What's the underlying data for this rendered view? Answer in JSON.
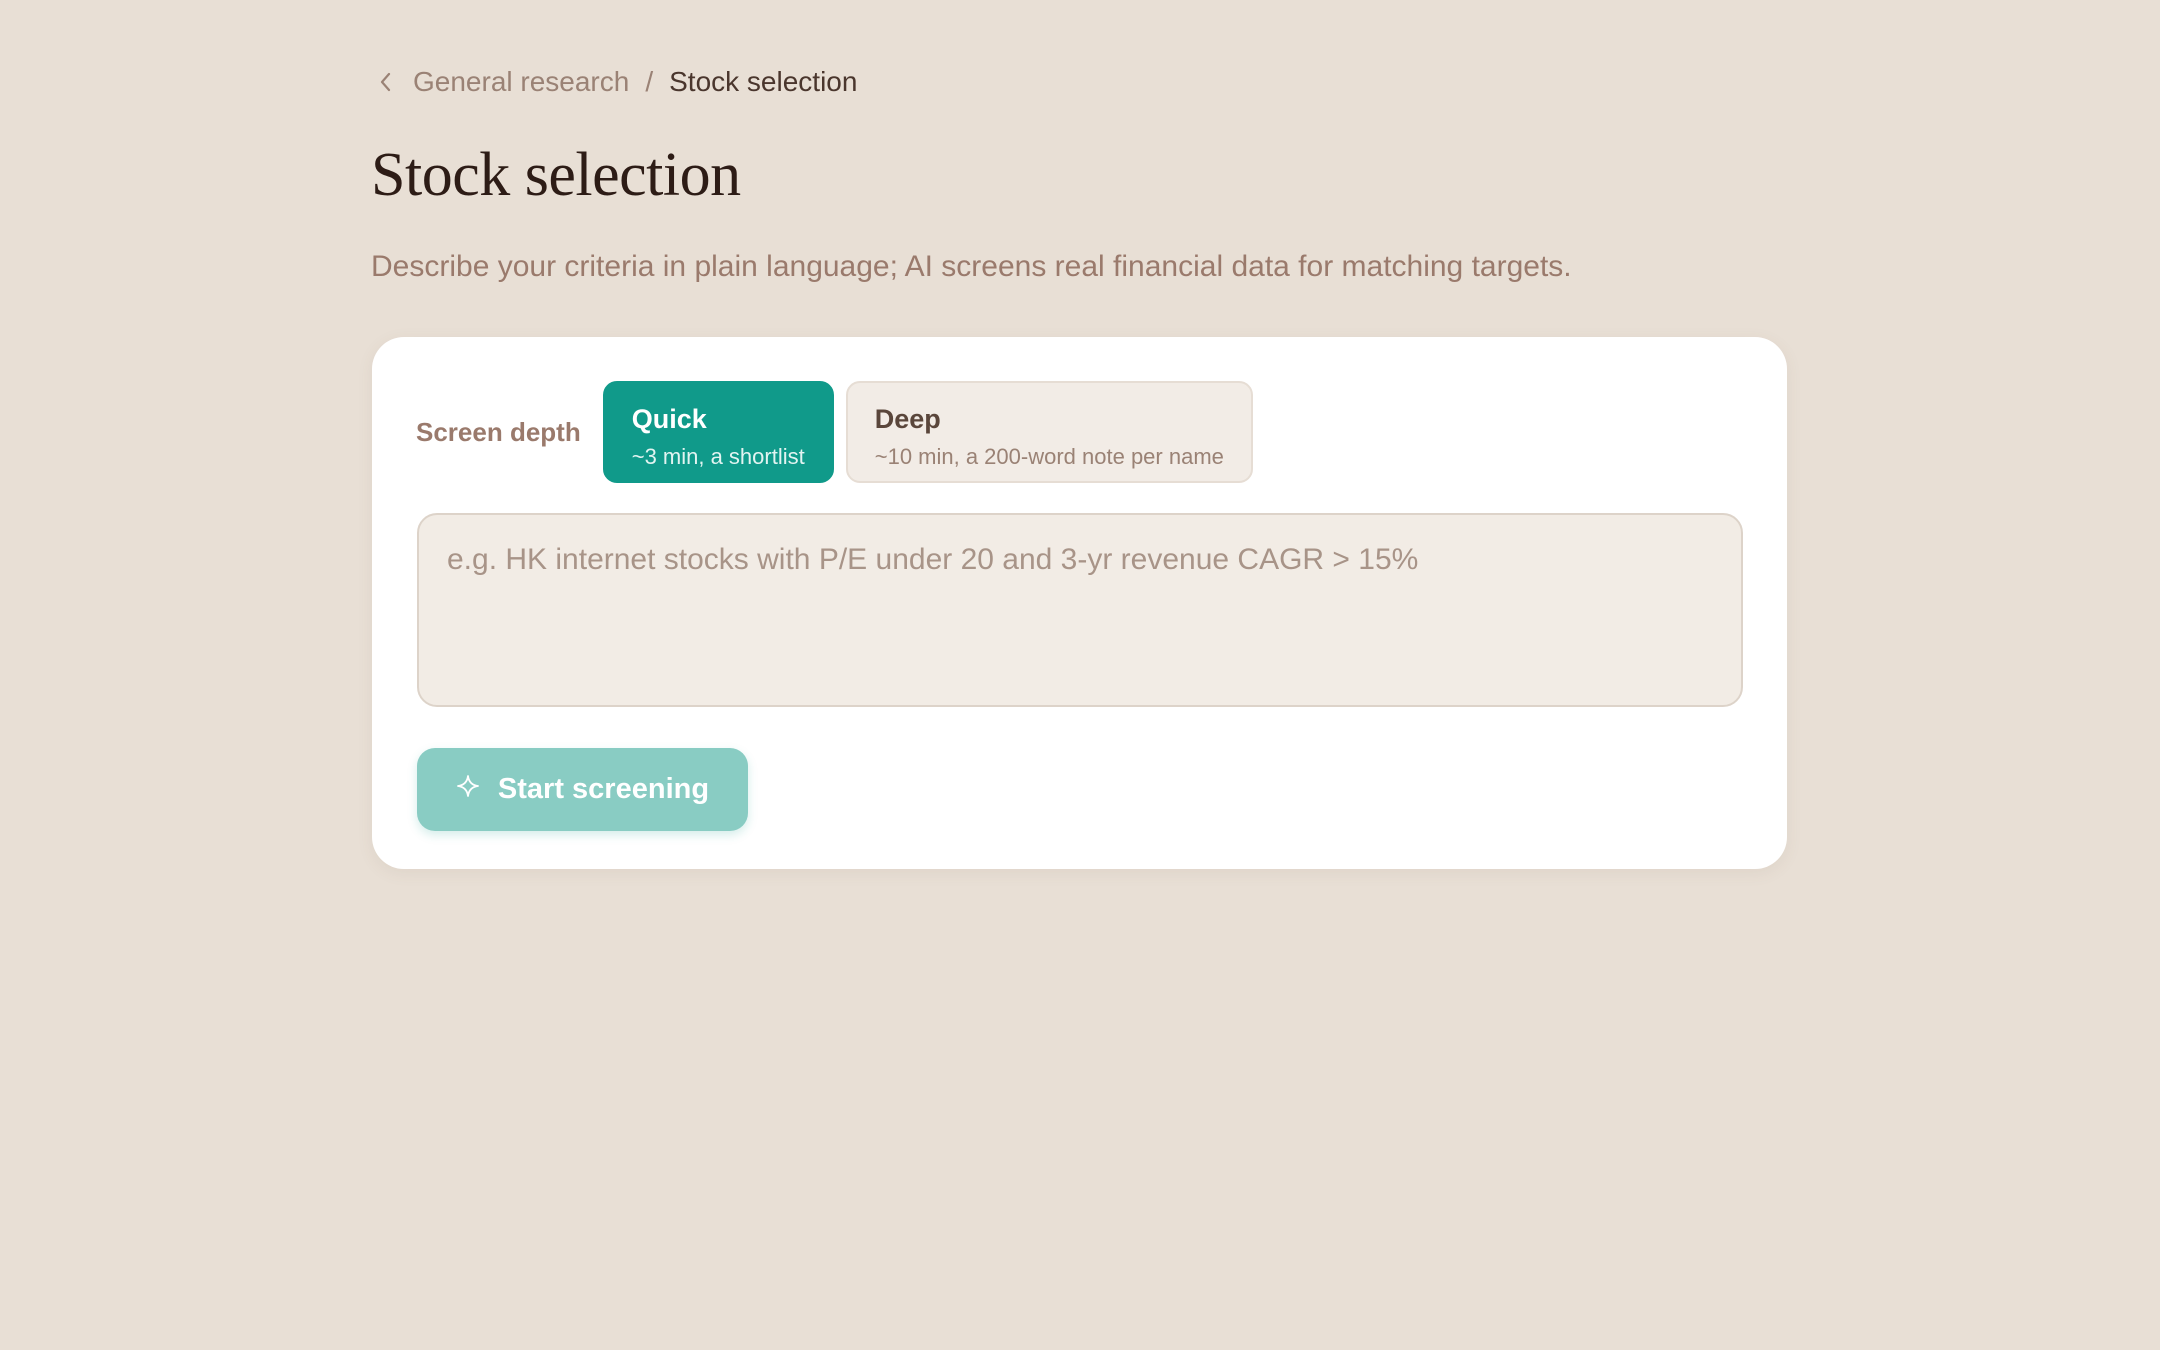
{
  "breadcrumb": {
    "parent": "General research",
    "separator": "/",
    "current": "Stock selection"
  },
  "page": {
    "title": "Stock selection",
    "subtitle": "Describe your criteria in plain language; AI screens real financial data for matching targets."
  },
  "depth": {
    "label": "Screen depth",
    "selected": "Quick",
    "options": [
      {
        "title": "Quick",
        "description": "~3 min, a shortlist"
      },
      {
        "title": "Deep",
        "description": "~10 min, a 200-word note per name"
      }
    ]
  },
  "criteria": {
    "value": "",
    "placeholder": "e.g. HK internet stocks with P/E under 20 and 3-yr revenue CAGR > 15%"
  },
  "actions": {
    "start_label": "Start screening",
    "start_icon": "sparkle-icon"
  },
  "colors": {
    "background": "#e8dfd5",
    "accent": "#109a8a",
    "accent_disabled": "#89ccc3"
  }
}
